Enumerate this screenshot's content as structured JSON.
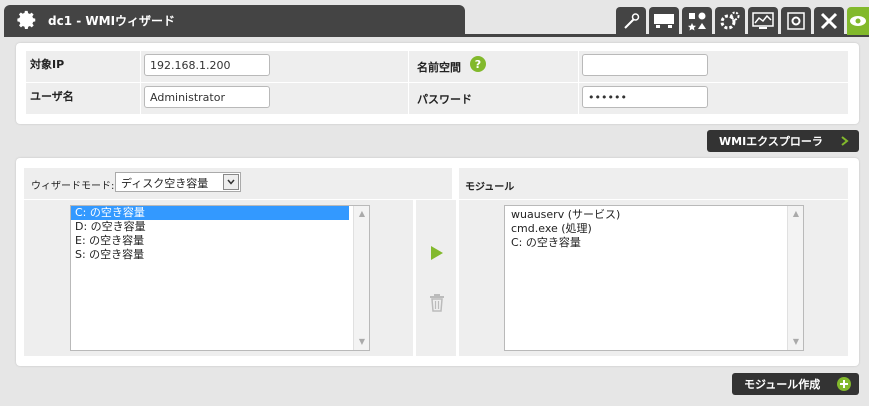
{
  "window": {
    "title": "dc1 - WMIウィザード",
    "toolbar_icons": [
      "wand-icon",
      "monitor-icon",
      "shapes-icon",
      "gears-icon",
      "chart-monitor-icon",
      "settings-icon",
      "wrench-icon",
      "eye-icon"
    ]
  },
  "target": {
    "ip_label": "対象IP",
    "ip_value": "192.168.1.200",
    "namespace_label": "名前空間",
    "namespace_value": "",
    "user_label": "ユーザ名",
    "user_value": "Administrator",
    "password_label": "パスワード",
    "password_value": "••••••"
  },
  "explorer_button": "WMIエクスプローラ",
  "wizard": {
    "mode_label": "ウィザードモード:",
    "mode_value": "ディスク空き容量",
    "modules_header": "モジュール",
    "available": [
      "C: の空き容量",
      "D: の空き容量",
      "E: の空き容量",
      "S: の空き容量"
    ],
    "selected_index": 0,
    "modules": [
      "wuauserv (サービス)",
      "cmd.exe (処理)",
      "C: の空き容量"
    ]
  },
  "create_button": "モジュール作成",
  "colors": {
    "accent": "#82b92c",
    "dark": "#444444",
    "selection": "#3399ff"
  }
}
